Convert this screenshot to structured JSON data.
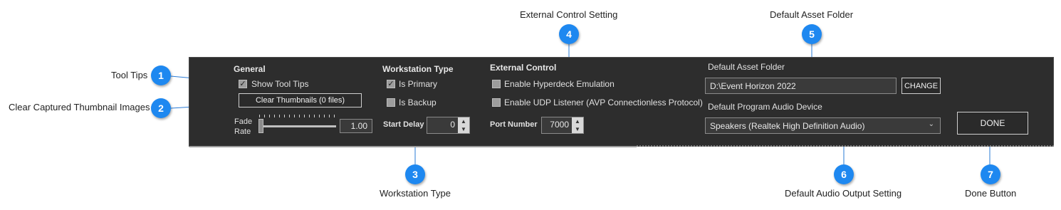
{
  "callouts": {
    "c1": {
      "num": "1",
      "label": "Tool Tips"
    },
    "c2": {
      "num": "2",
      "label": "Clear Captured Thumbnail Images"
    },
    "c3": {
      "num": "3",
      "label": "Workstation Type"
    },
    "c4": {
      "num": "4",
      "label": "External Control Setting"
    },
    "c5": {
      "num": "5",
      "label": "Default Asset Folder"
    },
    "c6": {
      "num": "6",
      "label": "Default Audio Output Setting"
    },
    "c7": {
      "num": "7",
      "label": "Done Button"
    }
  },
  "general": {
    "heading": "General",
    "show_tool_tips": "Show Tool Tips",
    "clear_thumbnails": "Clear Thumbnails (0 files)",
    "fade_label_1": "Fade",
    "fade_label_2": "Rate",
    "fade_value": "1.00"
  },
  "workstation": {
    "heading": "Workstation Type",
    "is_primary": "Is Primary",
    "is_backup": "Is Backup",
    "start_delay_label": "Start Delay",
    "start_delay_value": "0"
  },
  "external": {
    "heading": "External Control",
    "hyperdeck": "Enable Hyperdeck Emulation",
    "udp": "Enable UDP Listener (AVP Connectionless Protocol)",
    "port_label": "Port Number",
    "port_value": "7000"
  },
  "asset": {
    "heading": "Default Asset Folder",
    "path": "D:\\Event Horizon 2022",
    "change": "CHANGE",
    "audio_heading": "Default Program Audio Device",
    "audio_device": "Speakers (Realtek High Definition Audio)",
    "done": "DONE"
  },
  "state": {
    "show_tool_tips_checked": true,
    "is_primary_checked": true,
    "is_backup_checked": false,
    "hyperdeck_checked": false,
    "udp_checked": false
  },
  "colors": {
    "badge": "#1e88f0",
    "panel": "#2d2d2d"
  }
}
